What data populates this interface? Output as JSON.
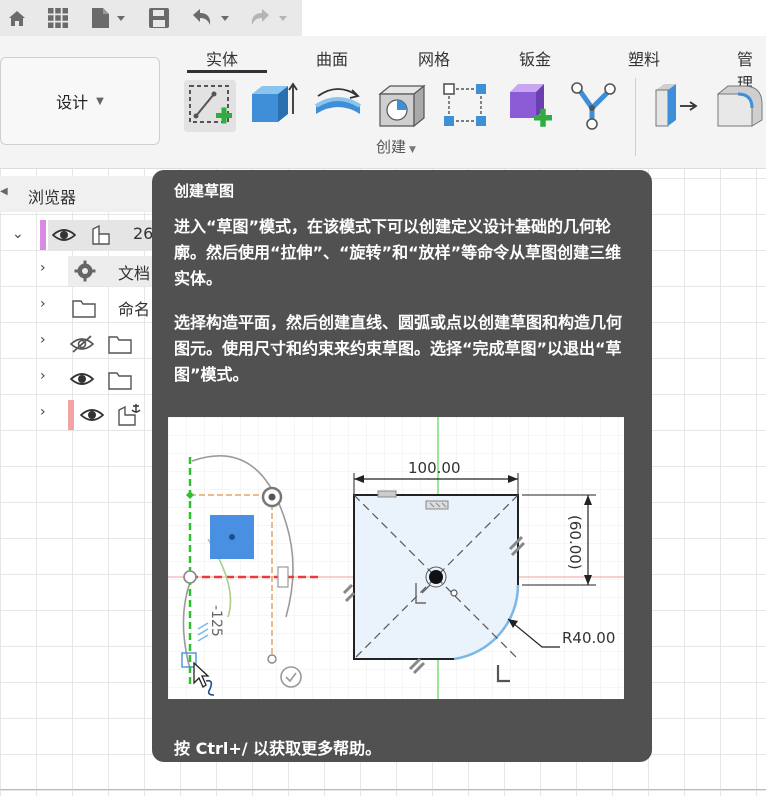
{
  "ribbon": {
    "workspace_button": "设计",
    "tabs": [
      "实体",
      "曲面",
      "网格",
      "钣金",
      "塑料",
      "管理"
    ],
    "active_tab": "实体",
    "create_group_label": "创建"
  },
  "browser": {
    "title": "浏览器",
    "root_label": "26",
    "items": [
      "文档",
      "命名"
    ]
  },
  "tooltip": {
    "title": "创建草图",
    "paragraph1": "进入“草图”模式，在该模式下可以创建定义设计基础的几何轮廓。然后使用“拉伸”、“旋转”和“放样”等命令从草图创建三维实体。",
    "paragraph2": "选择构造平面，然后创建直线、圆弧或点以创建草图和构造几何图元。使用尺寸和约束来约束草图。选择“完成草图”以退出“草图”模式。",
    "footer": "按 Ctrl+/ 以获取更多帮助。",
    "illustration": {
      "dim_width": "100.00",
      "dim_height": "(60.00)",
      "dim_radius": "R40.00",
      "dim_left": "-125"
    }
  },
  "colors": {
    "tooltip_bg": "#515151",
    "accent_blue": "#4a90d9",
    "constraint_green": "#2fbf2f",
    "axis_red": "#e83b3b"
  }
}
